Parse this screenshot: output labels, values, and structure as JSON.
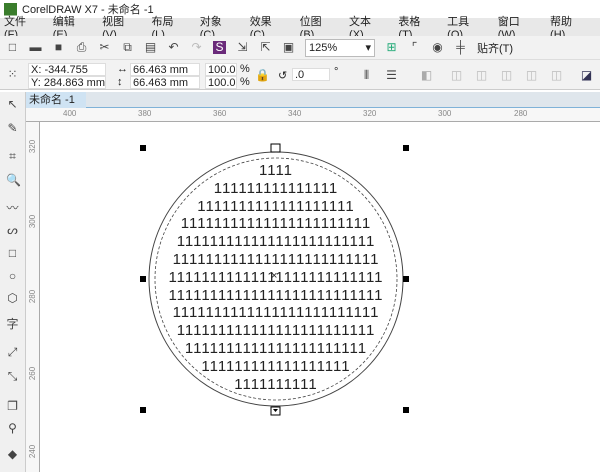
{
  "app": {
    "title": "CorelDRAW X7 - 未命名 -1"
  },
  "menu": [
    "文件(F)",
    "编辑(E)",
    "视图(V)",
    "布局(L)",
    "对象(C)",
    "效果(C)",
    "位图(B)",
    "文本(X)",
    "表格(T)",
    "工具(O)",
    "窗口(W)",
    "帮助(H)"
  ],
  "toolbar": {
    "zoom": "125%",
    "snap": "贴齐(T)"
  },
  "props": {
    "x": "X: -344.755 mm",
    "y": "Y: 284.863 mm",
    "w": "66.463 mm",
    "h": "66.463 mm",
    "sx": "100.0",
    "sy": "100.0",
    "pct": "%",
    "angle": ".0",
    "deg": "°"
  },
  "doc": {
    "tab": "未命名 -1"
  },
  "ruler": {
    "h": [
      "400",
      "380",
      "360",
      "340",
      "320",
      "300",
      "280"
    ],
    "v": [
      "320",
      "300",
      "280",
      "260",
      "240"
    ]
  },
  "canvas": {
    "lines": [
      "1111",
      "111111111111111",
      "1111111111111111111",
      "11111111111111111111111",
      "111111111111111111111111",
      "1111111111111111111111111",
      "11111111111111111111111111",
      "11111111111111111111111111",
      "1111111111111111111111111",
      "111111111111111111111111",
      "1111111111111111111111",
      "111111111111111111",
      "1111111111"
    ]
  }
}
